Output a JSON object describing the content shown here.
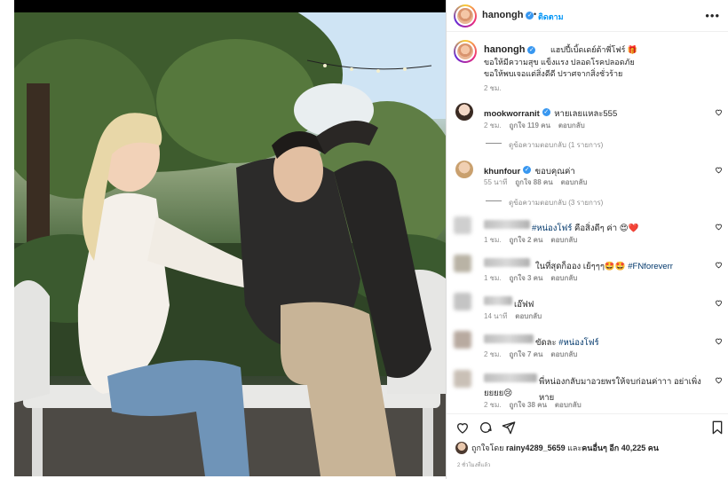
{
  "post": {
    "username": "hanongh",
    "follow_label": "ติดตาม",
    "caption_username": "hanongh",
    "caption_lines": [
      "แฮปปี้เบิ้ดเดย์ต้าพี่โฟร์ 🎁",
      "ขอให้มีความสุข แข็งแรง ปลอดโรคปลอดภัย",
      "ขอให้พบเจอแต่สิ่งดีดี ปราศจากสิ่งชั่วร้าย"
    ],
    "caption_time": "2 ชม."
  },
  "comments": [
    {
      "username": "mookworranit",
      "verified": true,
      "text": "หายเลยแหละ555",
      "time": "2 ชม.",
      "likes": "ถูกใจ 119 คน",
      "reply": "ตอบกลับ",
      "view_replies": "ดูข้อความตอบกลับ (1 รายการ)"
    },
    {
      "username": "khunfour",
      "verified": true,
      "text": "ขอบคุณค่า",
      "time": "55 นาที",
      "likes": "ถูกใจ 88 คน",
      "reply": "ตอบกลับ",
      "view_replies": "ดูข้อความตอบกลับ (3 รายการ)"
    },
    {
      "text_pre": "",
      "tag": "#หน่องโฟร์",
      "text_post": " คือสิ่งดีๆ ค่า 😍❤️",
      "time": "1 ชม.",
      "likes": "ถูกใจ 2 คน",
      "reply": "ตอบกลับ"
    },
    {
      "text_pre": "ในที่สุดก็ออง เย้ๆๆๆ🤩🤩 ",
      "tag": "#FNforeverr",
      "text_post": "",
      "time": "1 ชม.",
      "likes": "ถูกใจ 3 คน",
      "reply": "ตอบกลับ"
    },
    {
      "text_pre": "เอ๊ฟฟ",
      "tag": "",
      "text_post": "",
      "time": "14 นาที",
      "likes": "",
      "reply": "ตอบกลับ"
    },
    {
      "text_pre": "ขัดละ ",
      "tag": "#หน่องโฟร์",
      "text_post": "",
      "time": "2 ชม.",
      "likes": "ถูกใจ 7 คน",
      "reply": "ตอบกลับ"
    },
    {
      "text_pre": "พี่หน่องกลับมาอวยพรให้จบก่อนค่าาา อย่าเพิ่งหาย",
      "text_line2": "ยยยย😢",
      "tag": "",
      "text_post": "",
      "time": "2 ชม.",
      "likes": "ถูกใจ 38 คน",
      "reply": "ตอบกลับ"
    }
  ],
  "footer": {
    "likes_prefix": "ถูกใจโดย",
    "likes_user": "rainy4289_5659",
    "likes_middle": "และ",
    "likes_others": "คนอื่นๆ อีก 40,225 คน",
    "time": "2 ชั่วโมงที่แล้ว"
  },
  "icons": {
    "heart": "heart-icon",
    "comment": "comment-icon",
    "share": "share-icon",
    "bookmark": "bookmark-icon",
    "more": "more-icon"
  },
  "colors": {
    "link_blue": "#0095f6",
    "verified_blue": "#3897f0",
    "hashtag": "#00376b",
    "muted": "#8e8e8e"
  }
}
